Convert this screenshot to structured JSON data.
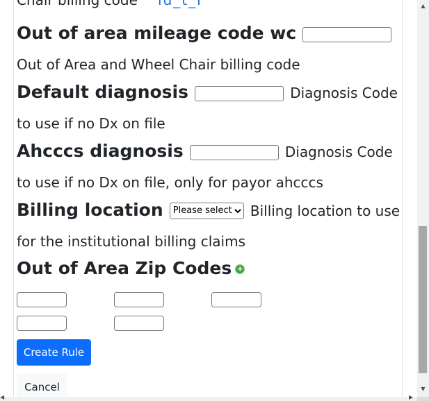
{
  "top_cut": {
    "text": "Chair billing code",
    "link_text": "ld_t_l"
  },
  "fields": {
    "out_of_area_mileage": {
      "label": "Out of area mileage code wc",
      "value": "",
      "description": "Out of Area and Wheel Chair billing code"
    },
    "default_diagnosis": {
      "label": "Default diagnosis",
      "value": "",
      "description": "Diagnosis Code to use if no Dx on file"
    },
    "ahcccs_diagnosis": {
      "label": "Ahcccs diagnosis",
      "value": "",
      "description": "Diagnosis Code to use if no Dx on file, only for payor ahcccs"
    },
    "billing_location": {
      "label": "Billing location",
      "selected": "Please select",
      "description": "Billing location to use for the institutional billing claims"
    }
  },
  "zip_codes": {
    "title": "Out of Area Zip Codes",
    "add_icon": "plus-circle-icon",
    "values": [
      "",
      "",
      "",
      "",
      ""
    ]
  },
  "actions": {
    "create_label": "Create Rule",
    "cancel_label": "Cancel"
  },
  "colors": {
    "primary": "#0d6efd",
    "add_icon": "#3ea23e",
    "link": "#1a73d9"
  }
}
